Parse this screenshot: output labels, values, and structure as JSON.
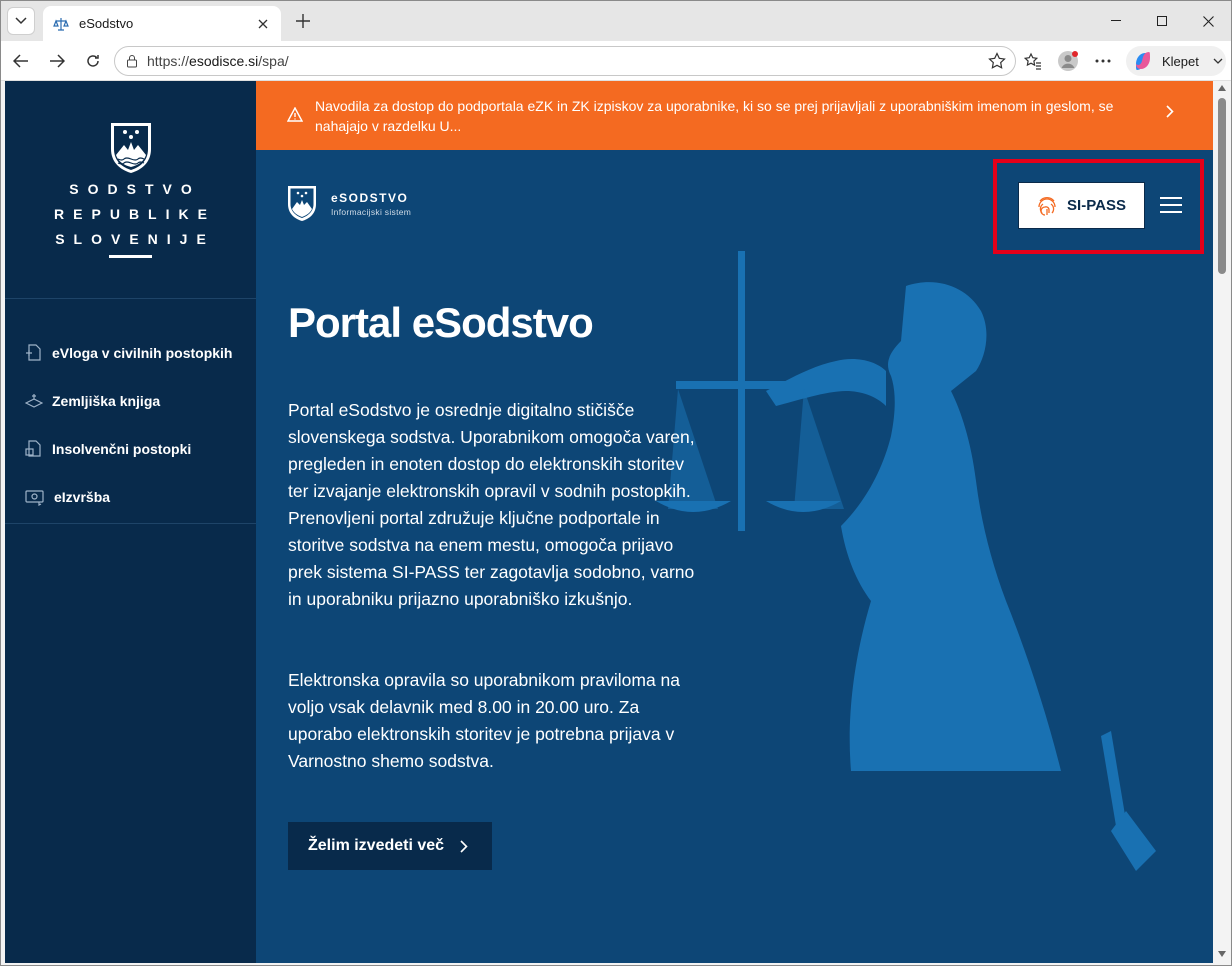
{
  "browser": {
    "tab_title": "eSodstvo",
    "url_prefix": "https://",
    "url_domain": "esodisce.si",
    "url_path": "/spa/",
    "copilot_label": "Klepet"
  },
  "sidebar": {
    "brand_lines": [
      "SODSTVO",
      "REPUBLIKE",
      "SLOVENIJE"
    ],
    "items": [
      {
        "label": "eVloga v civilnih postopkih",
        "icon": "file-add-icon"
      },
      {
        "label": "Zemljiška knjiga",
        "icon": "land-registry-icon"
      },
      {
        "label": "Insolvenčni postopki",
        "icon": "insolvency-icon"
      },
      {
        "label": "eIzvršba",
        "icon": "enforcement-icon"
      }
    ]
  },
  "alert": {
    "text": "Navodila za dostop do podportala eZK in ZK izpiskov za uporabnike, ki so se prej prijavljali z uporabniškim imenom in geslom, se nahajajo v razdelku U...",
    "color": "#f46a21"
  },
  "header": {
    "logo_name": "eSODSTVO",
    "logo_sub": "Informacijski sistem",
    "login_label": "SI-PASS"
  },
  "hero": {
    "title": "Portal eSodstvo",
    "paragraph1": "Portal eSodstvo je osrednje digitalno stičišče slovenskega sodstva. Uporabnikom omogoča varen, pregleden in enoten dostop do elektronskih storitev ter izvajanje elektronskih opravil v sodnih postopkih. Prenovljeni portal združuje ključne podportale in storitve sodstva na enem mestu, omogoča prijavo prek sistema SI-PASS ter zagotavlja sodobno, varno in uporabniku prijazno uporabniško izkušnjo.",
    "paragraph2": "Elektronska opravila so uporabnikom praviloma na voljo vsak delavnik med 8.00 in 20.00 uro. Za uporabo elektronskih storitev je potrebna prijava v Varnostno shemo sodstva.",
    "cta_label": "Želim izvedeti več"
  },
  "colors": {
    "sidebar_bg": "#082a4b",
    "main_bg": "#0d4676",
    "highlight": "#e5001a"
  }
}
